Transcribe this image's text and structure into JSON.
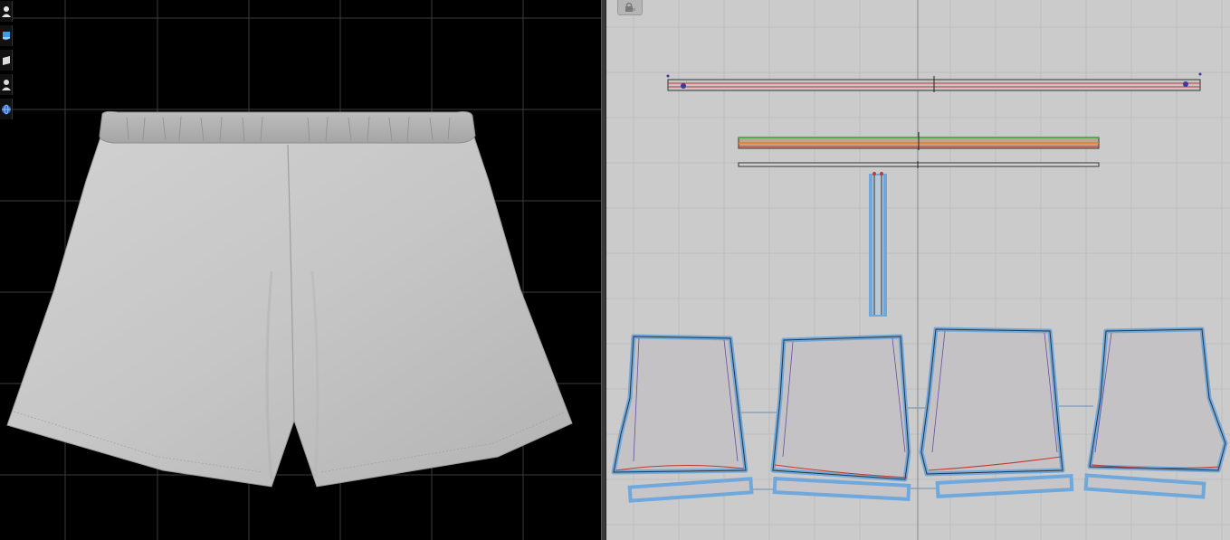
{
  "app": {
    "panes": [
      "3d-garment-window",
      "2d-pattern-window"
    ]
  },
  "toolbar3d": {
    "buttons": [
      {
        "id": "avatar-display",
        "icon": "avatar-icon"
      },
      {
        "id": "garment-display",
        "icon": "shirt-icon",
        "active": true
      },
      {
        "id": "texture-display",
        "icon": "fabric-icon"
      },
      {
        "id": "avatar-silhouette",
        "icon": "silhouette-icon"
      },
      {
        "id": "environment",
        "icon": "globe-icon"
      }
    ]
  },
  "toolbar2d": {
    "lock": {
      "icon": "lock-icon"
    }
  },
  "colors": {
    "viewport3d_bg": "#000000",
    "viewport2d_bg": "#cbcbcb",
    "fabric": "#c8c8c8",
    "pattern_outline_selected": "#6fa8dc",
    "seam_green": "#4caf50",
    "seam_red": "#c0392b",
    "seam_orange": "#e67e22"
  }
}
